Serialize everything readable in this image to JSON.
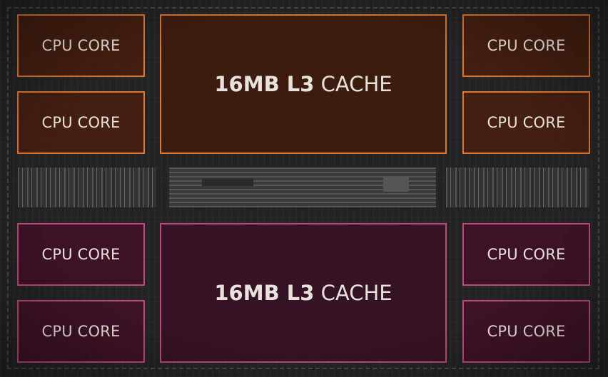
{
  "diagram": {
    "core_label": "CPU CORE",
    "cache_top": {
      "size": "16MB L3",
      "suffix": "CACHE"
    },
    "cache_bottom": {
      "size": "16MB L3",
      "suffix": "CACHE"
    },
    "colors": {
      "top_accent": "#e0782c",
      "bottom_accent": "#c2477e"
    }
  }
}
